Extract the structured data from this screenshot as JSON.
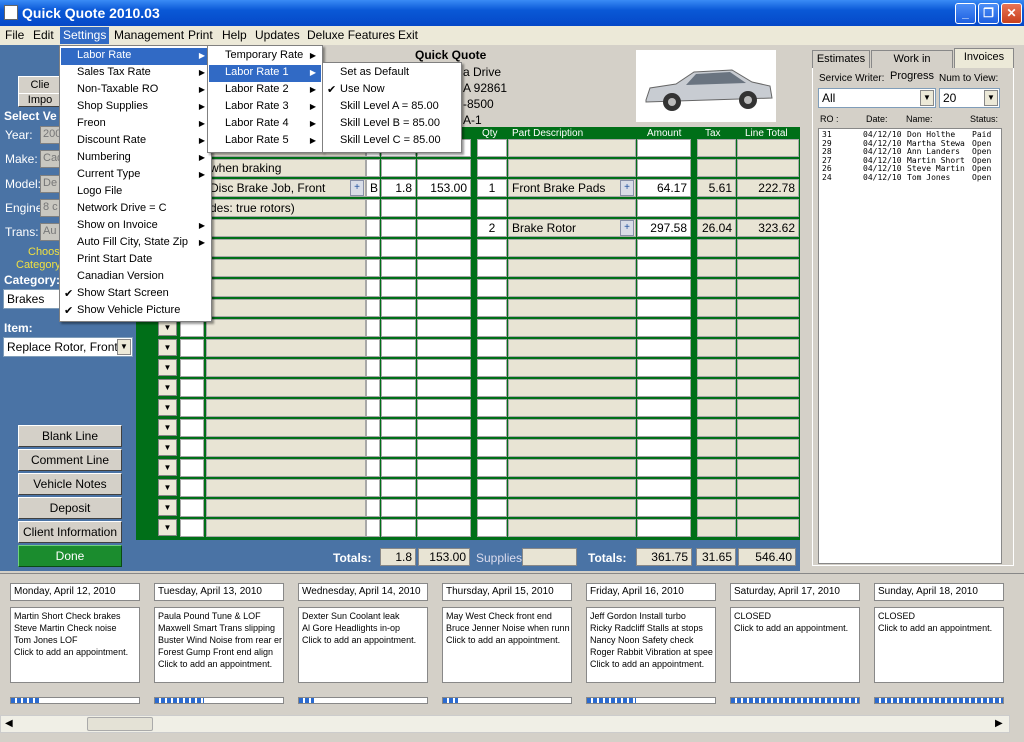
{
  "window": {
    "title": "Quick Quote 2010.03"
  },
  "menubar": [
    "File",
    "Edit",
    "Settings",
    "Management",
    "Print",
    "Help",
    "Updates",
    "Deluxe Features",
    "Exit"
  ],
  "settings_menu": [
    {
      "label": "Labor Rate",
      "submenu": true,
      "highlighted": true
    },
    {
      "label": "Sales Tax Rate",
      "submenu": true
    },
    {
      "label": "Non-Taxable RO",
      "submenu": true
    },
    {
      "label": "Shop Supplies",
      "submenu": true
    },
    {
      "label": "Freon",
      "submenu": true
    },
    {
      "label": "Discount Rate",
      "submenu": true
    },
    {
      "label": "Numbering",
      "submenu": true
    },
    {
      "label": "Current Type",
      "submenu": true
    },
    {
      "label": "Logo File"
    },
    {
      "label": "Network Drive = C"
    },
    {
      "label": "Show on Invoice",
      "submenu": true
    },
    {
      "label": "Auto Fill City, State Zip",
      "submenu": true
    },
    {
      "label": "Print Start Date"
    },
    {
      "label": "Canadian Version"
    },
    {
      "label": "Show Start Screen",
      "checked": true
    },
    {
      "label": "Show Vehicle Picture",
      "checked": true
    }
  ],
  "labor_rate_menu": [
    {
      "label": "Temporary Rate",
      "submenu": true
    },
    {
      "label": "Labor Rate 1",
      "submenu": true,
      "highlighted": true
    },
    {
      "label": "Labor Rate 2",
      "submenu": true
    },
    {
      "label": "Labor Rate 3",
      "submenu": true
    },
    {
      "label": "Labor Rate 4",
      "submenu": true
    },
    {
      "label": "Labor Rate 5",
      "submenu": true
    }
  ],
  "labor_rate1_menu": [
    {
      "label": "Set as Default",
      "checked": false
    },
    {
      "label": "Use Now",
      "checked": true
    },
    {
      "label": "Skill Level A = 85.00"
    },
    {
      "label": "Skill Level B = 85.00"
    },
    {
      "label": "Skill Level C = 85.00"
    }
  ],
  "left": {
    "client_btn": "Clie",
    "import_btn": "Impo",
    "select_vehicle": "Select Ve",
    "year_label": "Year:",
    "year_value": "200",
    "make_label": "Make:",
    "make_value": "Cad",
    "model_label": "Model:",
    "model_value": "De",
    "engine_label": "Engine",
    "engine_value": "8 c",
    "trans_label": "Trans:",
    "trans_value": "Au",
    "choose": "Choos",
    "category_link": "Category",
    "category_label": "Category:",
    "category_value": "Brakes",
    "item_label": "Item:",
    "item_value": "Replace Rotor, Front",
    "buttons": [
      "Blank Line",
      "Comment Line",
      "Vehicle Notes",
      "Deposit",
      "Client Information",
      "Done"
    ]
  },
  "header": {
    "shop_name": "Quick Quote",
    "address": "a Drive",
    "city": "A 92861",
    "phone": "-8500",
    "misc": "A-1"
  },
  "columns": {
    "qty": "Qty",
    "part": "Part Description",
    "amount": "Amount",
    "tax": "Tax",
    "line_total": "Line Total"
  },
  "lines": [
    {
      "labor": "when braking"
    },
    {
      "labor": "Disc Brake Job, Front",
      "skill": "B",
      "hours": "1.8",
      "labor_amount": "153.00",
      "qty": "1",
      "part": "Front Brake Pads",
      "amount": "64.17",
      "tax": "5.61",
      "total": "222.78"
    },
    {
      "labor": "des: true rotors)"
    },
    {
      "qty": "2",
      "part": "Brake Rotor",
      "amount": "297.58",
      "tax": "26.04",
      "total": "323.62"
    }
  ],
  "totals": {
    "label1": "Totals:",
    "hours": "1.8",
    "labor": "153.00",
    "supplies_label": "Supplies:",
    "label2": "Totals:",
    "parts": "361.75",
    "tax": "31.65",
    "grand": "546.40"
  },
  "right": {
    "tabs": [
      "Estimates",
      "Work in Progress",
      "Invoices"
    ],
    "service_writer_label": "Service Writer:",
    "num_label": "Num to View:",
    "service_writer": "All",
    "num": "20",
    "col_ro": "RO :",
    "col_date": "Date:",
    "col_name": "Name:",
    "col_status": "Status:",
    "rows": [
      {
        "ro": "31",
        "date": "04/12/10",
        "name": "Don Holthe",
        "status": "Paid"
      },
      {
        "ro": "29",
        "date": "04/12/10",
        "name": "Martha Stewa",
        "status": "Open"
      },
      {
        "ro": "28",
        "date": "04/12/10",
        "name": "Ann Landers",
        "status": "Open"
      },
      {
        "ro": "27",
        "date": "04/12/10",
        "name": "Martin Short",
        "status": "Open"
      },
      {
        "ro": "26",
        "date": "04/12/10",
        "name": "Steve Martin",
        "status": "Open"
      },
      {
        "ro": "24",
        "date": "04/12/10",
        "name": "Tom Jones",
        "status": "Open"
      }
    ]
  },
  "calendar": [
    {
      "date": "Monday, April 12, 2010",
      "items": [
        "Martin Short Check brakes",
        "Steve Martin Check noise",
        "Tom Jones LOF",
        "Click to add an appointment."
      ],
      "progress": 0.22
    },
    {
      "date": "Tuesday, April 13, 2010",
      "items": [
        "Paula Pound Tune & LOF",
        "Maxwell Smart Trans slipping",
        "Buster Wind Noise from rear er",
        "Forest Gump Front end align",
        "Click to add an appointment."
      ],
      "progress": 0.38
    },
    {
      "date": "Wednesday, April 14, 2010",
      "items": [
        "Dexter Sun Coolant leak",
        "Al Gore Headlights in-op",
        "Click to add an appointment."
      ],
      "progress": 0.12
    },
    {
      "date": "Thursday, April 15, 2010",
      "items": [
        "May West Check front end",
        "Bruce Jenner Noise when runn",
        "Click to add an appointment."
      ],
      "progress": 0.12
    },
    {
      "date": "Friday, April 16, 2010",
      "items": [
        "Jeff Gordon Install turbo",
        "Ricky Radcliff Stalls at stops",
        "Nancy Noon Safety check",
        "Roger Rabbit Vibration at spee",
        "Click to add an appointment."
      ],
      "progress": 0.38
    },
    {
      "date": "Saturday, April 17, 2010",
      "items": [
        "CLOSED",
        "Click to add an appointment."
      ],
      "progress": 1.0
    },
    {
      "date": "Sunday, April 18, 2010",
      "items": [
        "CLOSED",
        "Click to add an appointment."
      ],
      "progress": 1.0
    }
  ],
  "icons": {
    "app": "app-icon",
    "minimize": "minimize-icon",
    "restore": "restore-icon",
    "close": "close-icon",
    "check": "✔",
    "arrow": "▶",
    "dropdown": "▼"
  },
  "colors": {
    "title_bar": "#0a58d6",
    "menu_highlight": "#316ac5",
    "grid_green": "#006f18",
    "panel_blue": "#4a73a5",
    "done_green": "#1b8c2e"
  }
}
